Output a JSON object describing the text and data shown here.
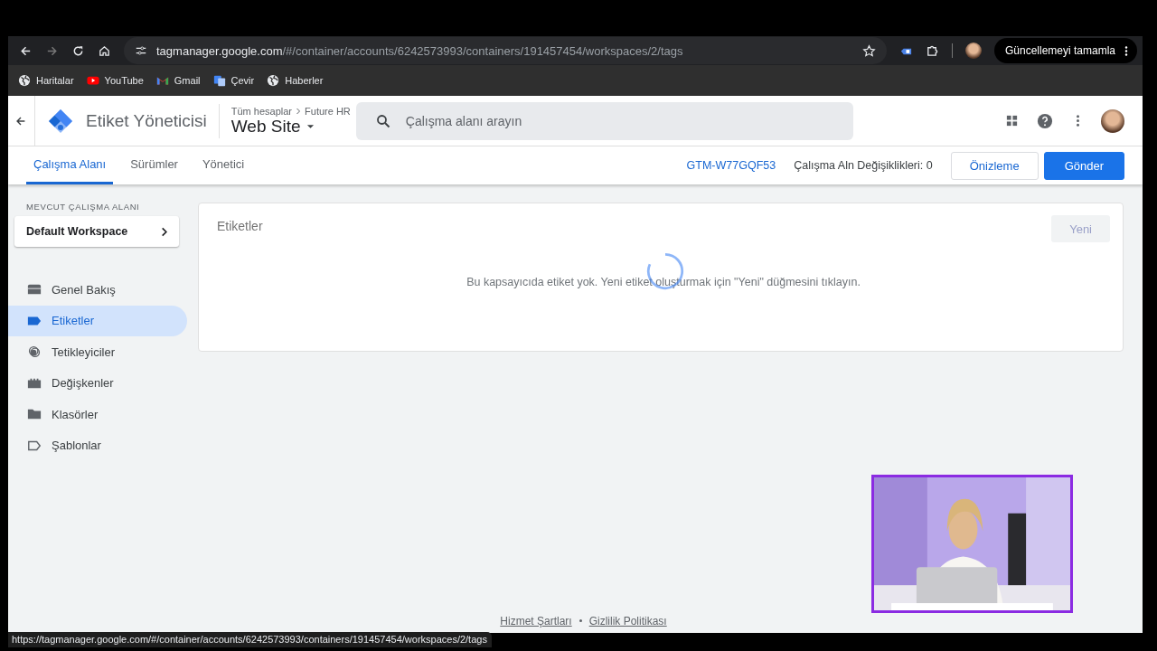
{
  "browser": {
    "url_host": "tagmanager.google.com",
    "url_path": "/#/container/accounts/6242573993/containers/191457454/workspaces/2/tags",
    "update_button": "Güncellemeyi tamamla",
    "bookmarks": [
      {
        "kind": "globe",
        "label": "Haritalar"
      },
      {
        "kind": "youtube",
        "label": "YouTube"
      },
      {
        "kind": "gmail",
        "label": "Gmail"
      },
      {
        "kind": "translate",
        "label": "Çevir"
      },
      {
        "kind": "globe",
        "label": "Haberler"
      }
    ],
    "status_url": "https://tagmanager.google.com/#/container/accounts/6242573993/containers/191457454/workspaces/2/tags"
  },
  "app": {
    "title": "Etiket Yöneticisi",
    "breadcrumb": [
      "Tüm hesaplar",
      "Future HR"
    ],
    "container": "Web Site",
    "search": {
      "placeholder": "Çalışma alanı arayın"
    }
  },
  "tabs": [
    {
      "label": "Çalışma Alanı",
      "selected": true
    },
    {
      "label": "Sürümler",
      "selected": false
    },
    {
      "label": "Yönetici",
      "selected": false
    }
  ],
  "container_id": "GTM-W77GQF53",
  "changes": "Çalışma Aln Değişiklikleri: 0",
  "preview_button": "Önizleme",
  "submit_button": "Gönder",
  "sidebar": {
    "workspace_heading": "MEVCUT ÇALIŞMA ALANI",
    "workspace_name": "Default Workspace",
    "items": [
      {
        "kind": "overview",
        "label": "Genel Bakış",
        "selected": false
      },
      {
        "kind": "tags",
        "label": "Etiketler",
        "selected": true
      },
      {
        "kind": "triggers",
        "label": "Tetikleyiciler",
        "selected": false
      },
      {
        "kind": "variables",
        "label": "Değişkenler",
        "selected": false
      },
      {
        "kind": "folders",
        "label": "Klasörler",
        "selected": false
      },
      {
        "kind": "templates",
        "label": "Şablonlar",
        "selected": false
      }
    ]
  },
  "card": {
    "title": "Etiketler",
    "new_button": "Yeni",
    "new_disabled": true,
    "empty_message": "Bu kapsayıcıda etiket yok. Yeni etiket oluşturmak için \"Yeni\" düğmesini tıklayın.",
    "loading": true
  },
  "footer": [
    "Hizmet Şartları",
    "Gizlilik Politikası"
  ],
  "video_overlay": {
    "kind": "picture"
  }
}
